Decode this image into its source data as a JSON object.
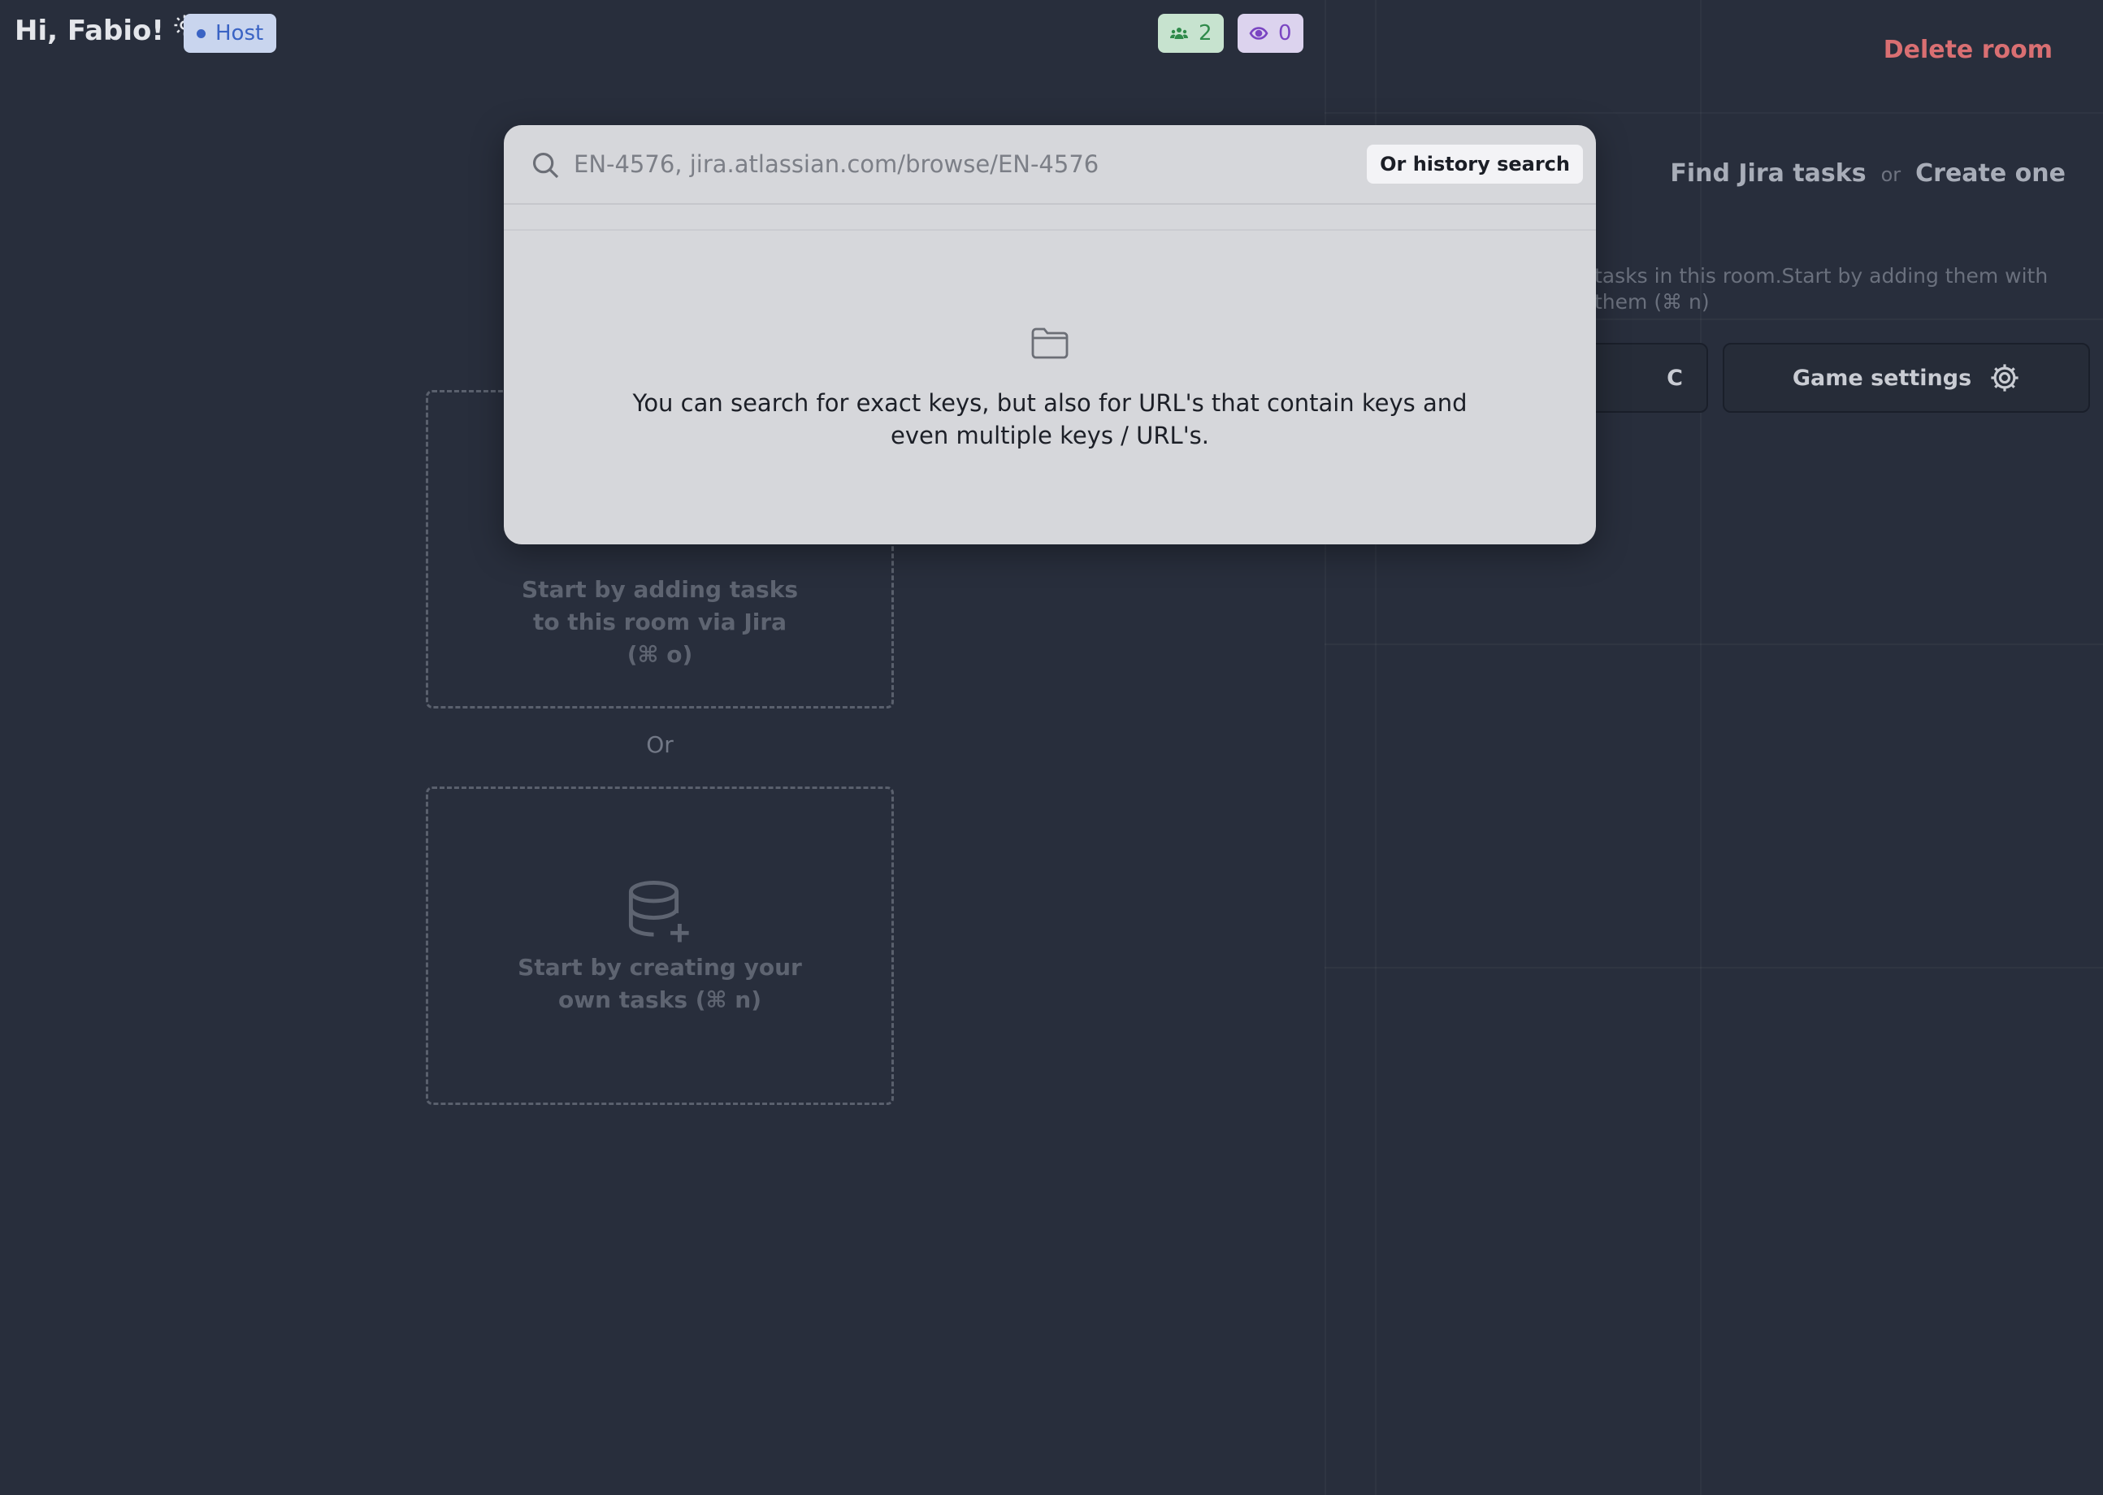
{
  "header": {
    "greeting": "Hi, Fabio!",
    "role_badge": "Host",
    "participants_count": "2",
    "spectators_count": "0",
    "delete_room_label": "Delete room"
  },
  "right_panel": {
    "find_jira_label": "Find Jira tasks",
    "or_label": "or",
    "create_one_label": "Create one",
    "hint_text": "tasks in this room.Start by adding them with them (⌘ n)",
    "hidden_button_fragment": "C",
    "game_settings_label": "Game settings"
  },
  "left_panel": {
    "jira_card_text": "Start by adding tasks to this room via Jira (⌘ o)",
    "or_separator": "Or",
    "own_tasks_card_text": "Start by creating your own tasks (⌘ n)"
  },
  "search_modal": {
    "placeholder": "EN-4576, jira.atlassian.com/browse/EN-4576",
    "history_button_label": "Or history search",
    "empty_state_text": "You can search for exact keys, but also for URL's that contain keys and even multiple keys / URL's."
  },
  "colors": {
    "background": "#282e3c",
    "modal_background": "#d6d7db",
    "delete_accent": "#d96f72",
    "host_badge_bg": "#c9d5ee",
    "participants_bg": "#c7e3cf",
    "spectators_bg": "#dcd3ee"
  }
}
